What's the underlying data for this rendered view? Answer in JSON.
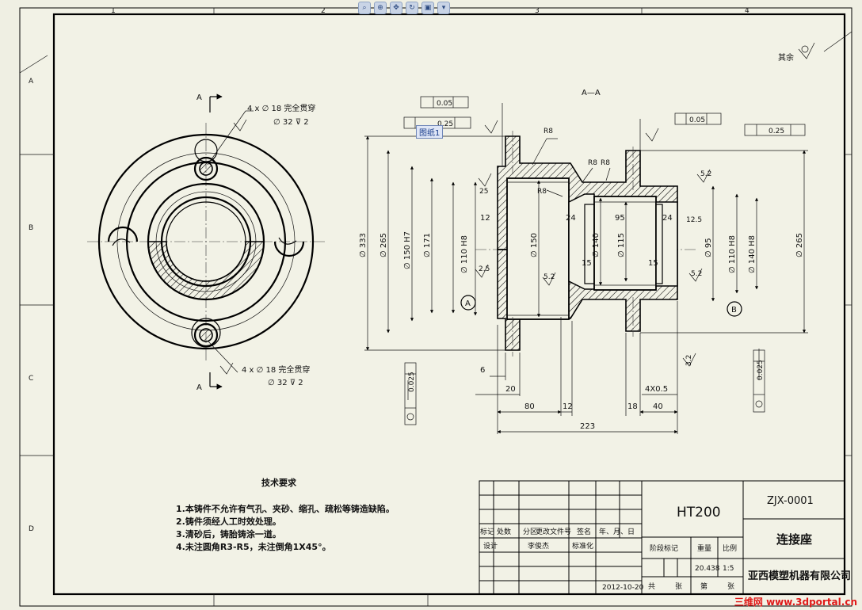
{
  "toolbar": {
    "icons": [
      "zoom-fit-icon",
      "zoom-area-icon",
      "pan-icon",
      "rotate-icon",
      "view-icon",
      "arrow-icon"
    ]
  },
  "drawing": {
    "section_label": "A—A",
    "section_mark": "A",
    "surface_rest": "其余",
    "tag_label": "图纸1",
    "hole_note_top": "4 x ∅ 18 完全贯穿",
    "hole_note_top_sub": "∅ 32 ⊽ 2",
    "hole_note_bottom": "4 x ∅ 18 完全贯穿",
    "hole_note_bottom_sub": "∅ 32 ⊽ 2",
    "radii": [
      "R8",
      "R8",
      "R8",
      "R8"
    ],
    "roughness": [
      "25",
      "2.5",
      "5.2",
      "12.5",
      "5.2",
      "5.2",
      "3.2"
    ],
    "inner_dims": [
      "12",
      "24",
      "95",
      "24",
      "15",
      "15"
    ],
    "left_dims": [
      "∅ 333",
      "∅ 265",
      "∅ 150 H7",
      "∅ 171",
      "∅ 110 H8",
      "∅ 150",
      "∅ 140",
      "∅ 115"
    ],
    "right_dims": [
      "∅ 95",
      "∅ 110 H8",
      "∅ 140 H8",
      "∅ 265"
    ],
    "bottom_dims": [
      "6",
      "20",
      "80",
      "12",
      "18",
      "40",
      "4X0.5",
      "223"
    ],
    "datum_a": "A",
    "datum_b": "B",
    "gdt_1": "0.05",
    "gdt_2": "0.25",
    "gdt_3": "0.05",
    "gdt_4": "0.25",
    "gdt_5": "0.025",
    "gdt_6": "0.025",
    "zone_letters": [
      "A",
      "B",
      "C",
      "D"
    ],
    "zone_numbers": [
      "1",
      "2",
      "3",
      "4"
    ]
  },
  "tech": {
    "title": "技术要求",
    "items": [
      "1.本铸件不允许有气孔、夹砂、缩孔、疏松等铸造缺陷。",
      "2.铸件须经人工时效处理。",
      "3.清砂后，铸胎铸涂一道。",
      "4.未注圆角R3-R5，未注倒角1X45°。"
    ]
  },
  "titleblock": {
    "material": "HT200",
    "code": "ZJX-0001",
    "part_name": "连接座",
    "company": "亚西模塑机器有限公司",
    "col_headers": [
      "标记",
      "处数",
      "分区",
      "更改文件号",
      "签名",
      "年、月、日"
    ],
    "designer_row": [
      "设计",
      "李俊杰",
      "",
      "标准化",
      "",
      ""
    ],
    "stage_label": "阶段标记",
    "weight_label": "重量",
    "scale_label": "比例",
    "weight_value": "20.438",
    "scale_value": "1:5",
    "date": "2012-10-20",
    "sheet_row": [
      "共",
      "张",
      "第",
      "张"
    ]
  },
  "watermark": "三维网 www.3dportal.cn"
}
